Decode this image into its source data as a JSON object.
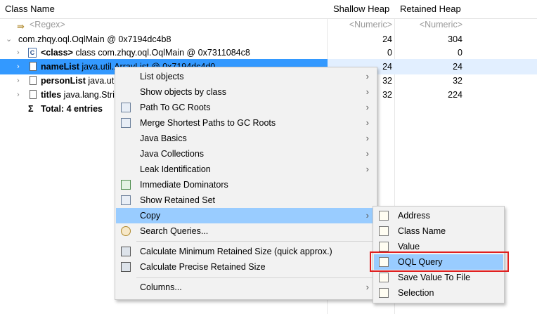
{
  "columns": {
    "class_name": "Class Name",
    "shallow_heap": "Shallow Heap",
    "retained_heap": "Retained Heap"
  },
  "filter_row": {
    "regex": "<Regex>",
    "numeric1": "<Numeric>",
    "numeric2": "<Numeric>"
  },
  "rows": [
    {
      "name": "com.zhqy.oql.OqlMain @ 0x7194dc4b8",
      "shallow": "24",
      "retained": "304"
    },
    {
      "bold": "<class>",
      "name": " class com.zhqy.oql.OqlMain @ 0x7311084c8",
      "shallow": "0",
      "retained": "0"
    },
    {
      "bold": "nameList",
      "name": " java.util.ArrayList @ 0x7194dc4d0",
      "shallow": "24",
      "retained": "24"
    },
    {
      "bold": "personList",
      "name": " java.util.ArrayList",
      "shallow": "32",
      "retained": "32"
    },
    {
      "bold": "titles",
      "name": " java.lang.String[]",
      "shallow": "32",
      "retained": "224"
    },
    {
      "bold": "Total: 4 entries",
      "name": "",
      "shallow": "",
      "retained": ""
    }
  ],
  "context_menu": [
    "List objects",
    "Show objects by class",
    "Path To GC Roots",
    "Merge Shortest Paths to GC Roots",
    "Java Basics",
    "Java Collections",
    "Leak Identification",
    "Immediate Dominators",
    "Show Retained Set",
    "Copy",
    "Search Queries...",
    "Calculate Minimum Retained Size (quick approx.)",
    "Calculate Precise Retained Size",
    "Columns..."
  ],
  "copy_submenu": [
    "Address",
    "Class Name",
    "Value",
    "OQL Query",
    "Save Value To File",
    "Selection"
  ],
  "colors": {
    "selection": "#3399ff",
    "menu_highlight": "#99ccff",
    "annotation_box": "#e02020"
  }
}
